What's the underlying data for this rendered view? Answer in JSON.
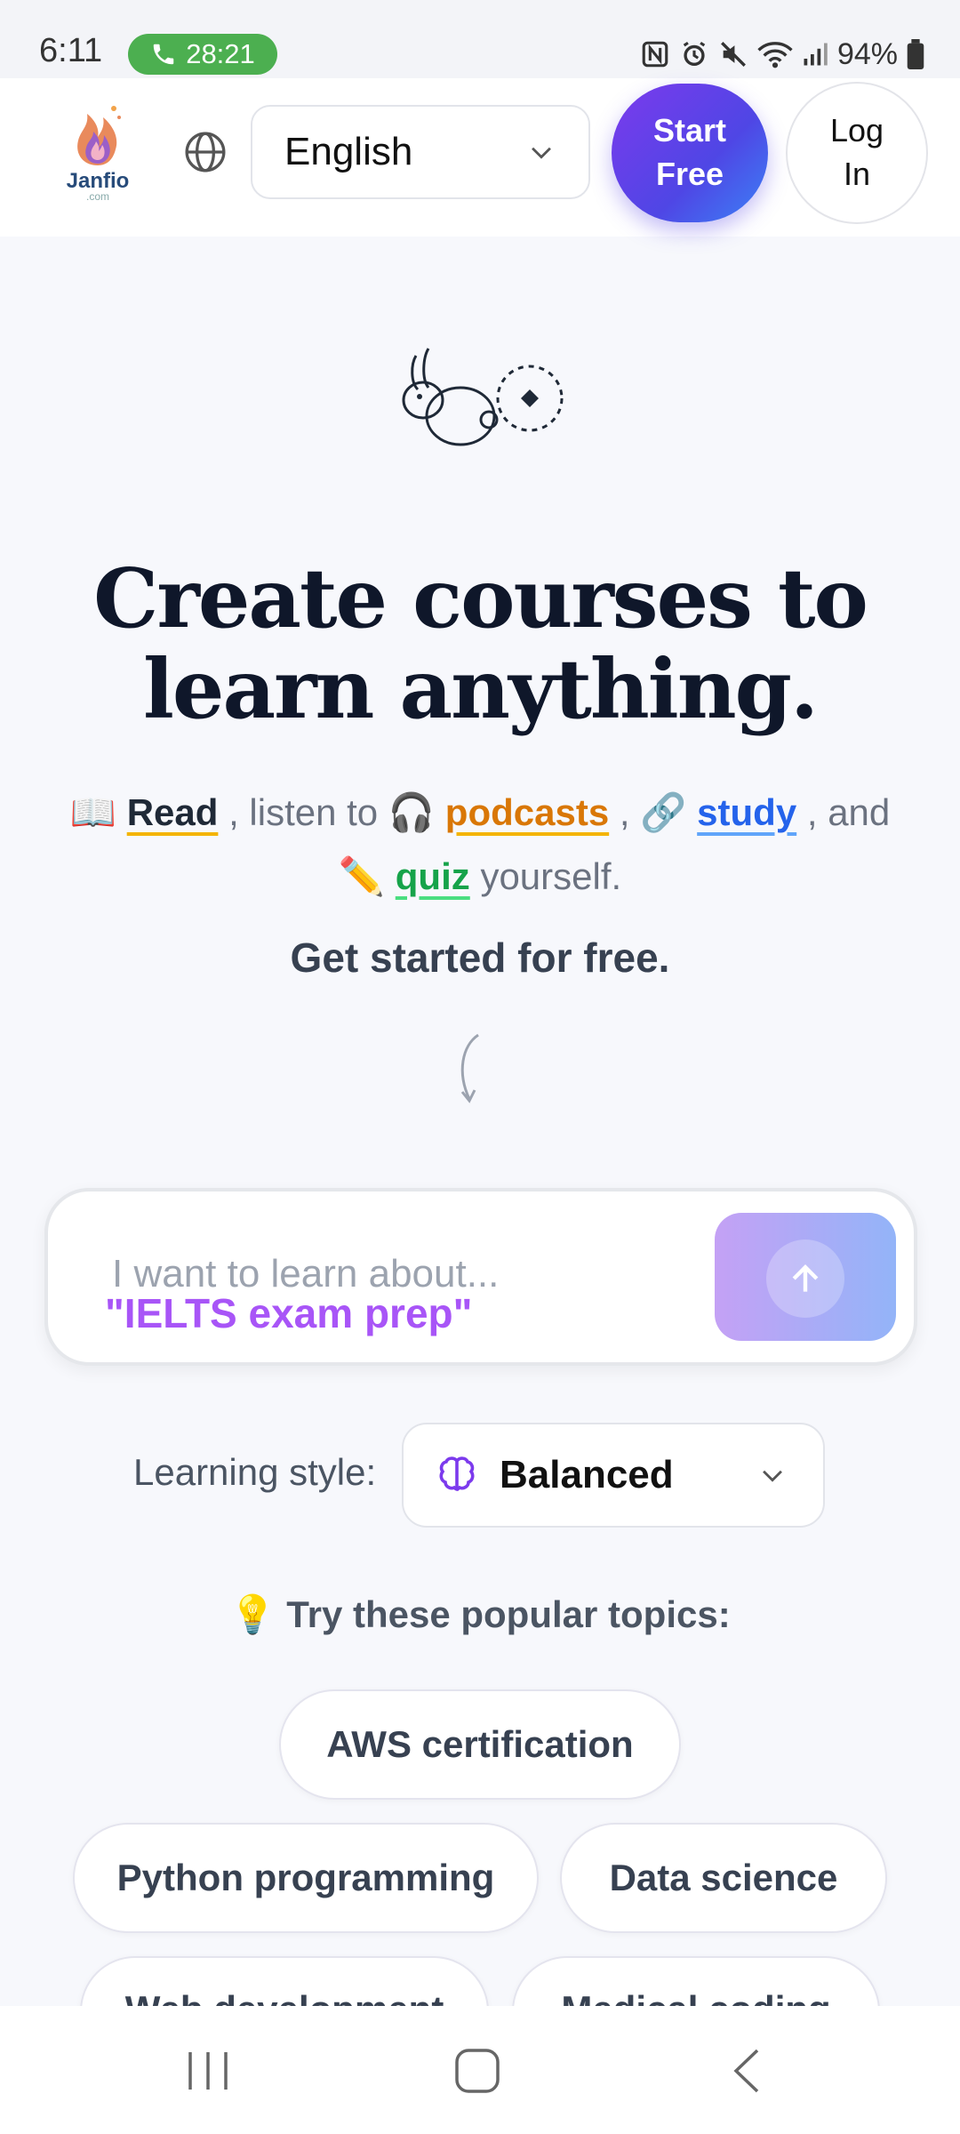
{
  "status_bar": {
    "time": "6:11",
    "call_duration": "28:21",
    "battery": "94%"
  },
  "header": {
    "logo_text": "Janfio",
    "logo_sub": ".com",
    "language": "English",
    "start_free": "Start Free",
    "log_in": "Log In"
  },
  "hero": {
    "headline": "Create courses to learn anything.",
    "sub": {
      "read": "Read",
      "listen": ", listen to",
      "podcasts": "podcasts",
      "comma": ",",
      "study": "study",
      "and": ", and",
      "quiz": "quiz",
      "yourself": "yourself."
    },
    "get_started": "Get started for free."
  },
  "input": {
    "placeholder": "I want to learn about...",
    "example": "\"IELTS exam prep\""
  },
  "learning_style": {
    "label": "Learning style:",
    "value": "Balanced"
  },
  "topics": {
    "title": "Try these popular topics:",
    "items": [
      "AWS certification",
      "Python programming",
      "Data science",
      "Web development",
      "Medical coding"
    ]
  },
  "colors": {
    "accent_purple": "#7c3aed",
    "accent_blue": "#3b82f6",
    "call_green": "#4caf50"
  }
}
